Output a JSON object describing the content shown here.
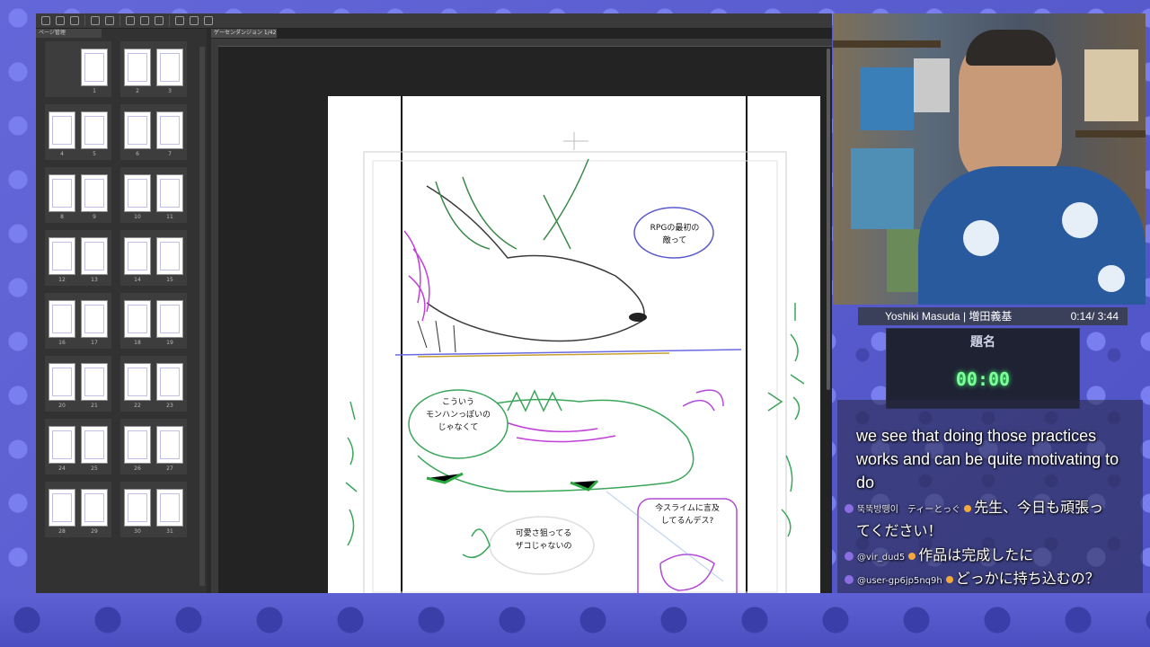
{
  "app": {
    "panel_tab": "ページ管理",
    "doc_tab": "ゲーセンダンジョン 1/42",
    "pages": [
      {
        "left": "",
        "right": "1"
      },
      {
        "left": "2",
        "right": "3"
      },
      {
        "left": "4",
        "right": "5"
      },
      {
        "left": "6",
        "right": "7"
      },
      {
        "left": "8",
        "right": "9"
      },
      {
        "left": "10",
        "right": "11"
      },
      {
        "left": "12",
        "right": "13"
      },
      {
        "left": "14",
        "right": "15"
      },
      {
        "left": "16",
        "right": "17"
      },
      {
        "left": "18",
        "right": "19"
      },
      {
        "left": "20",
        "right": "21"
      },
      {
        "left": "22",
        "right": "23"
      },
      {
        "left": "24",
        "right": "25"
      },
      {
        "left": "26",
        "right": "27"
      },
      {
        "left": "28",
        "right": "29"
      },
      {
        "left": "30",
        "right": "31"
      }
    ]
  },
  "manga": {
    "bubble1": "RPGの最初の\n敵って",
    "bubble2": "こういう\nモンハンっぽいの\nじゃなくて",
    "bubble3": "可愛さ狙ってる\nザコじゃないの",
    "bubble4": "今スライムに言及\nしてるんデス?"
  },
  "stream": {
    "streamer_name": "Yoshiki Masuda | 増田義基",
    "elapsed": "0:14/ 3:44",
    "timer_title": "題名",
    "timer_value": "00:00",
    "caption": "we see that doing those practices works and can be quite motivating to do",
    "chat": [
      {
        "user": "뚝뚝방뗑이　ティーとっぐ",
        "msg": "先生、今日も頑張っ"
      },
      {
        "user": "",
        "msg": "てください！"
      },
      {
        "user": "@vir_dud5",
        "msg": "作品は完成したに"
      },
      {
        "user": "@user-gp6jp5nq9h",
        "msg": "どっかに持ち込むの？"
      }
    ]
  },
  "colors": {
    "bg_purple": "#5b5fd0",
    "timer_green": "#7dff9a",
    "sketch_green": "#3aa65a",
    "sketch_purple": "#b24ad6",
    "sketch_blue": "#4a5ad0"
  }
}
